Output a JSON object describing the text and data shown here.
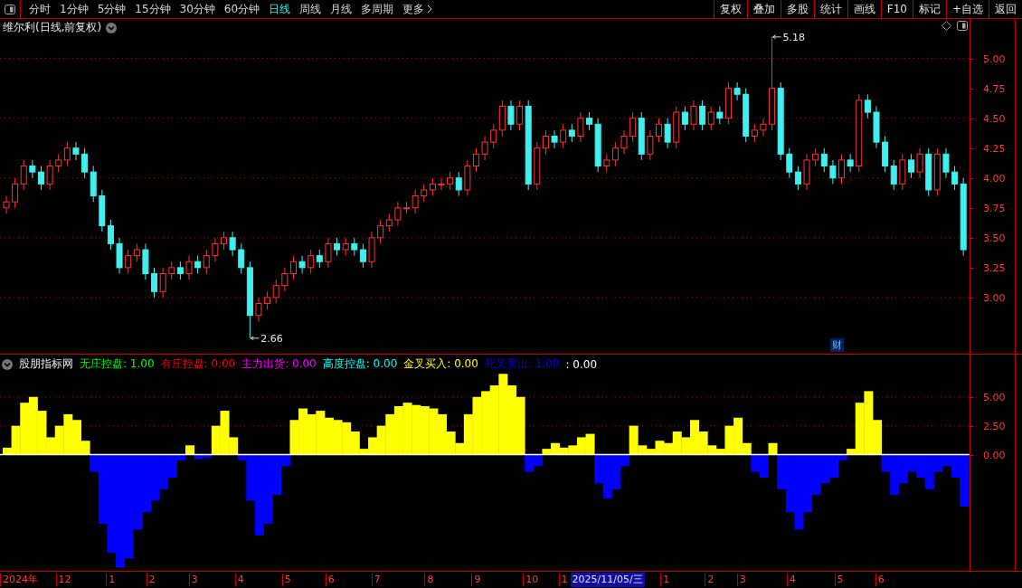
{
  "toolbar": {
    "periods": [
      {
        "label": "分时",
        "selected": false
      },
      {
        "label": "1分钟",
        "selected": false
      },
      {
        "label": "5分钟",
        "selected": false
      },
      {
        "label": "15分钟",
        "selected": false
      },
      {
        "label": "30分钟",
        "selected": false
      },
      {
        "label": "60分钟",
        "selected": false
      },
      {
        "label": "日线",
        "selected": true
      },
      {
        "label": "周线",
        "selected": false
      },
      {
        "label": "月线",
        "selected": false
      },
      {
        "label": "多周期",
        "selected": false
      },
      {
        "label": "更多",
        "selected": false
      }
    ],
    "buttons": [
      "复权",
      "叠加",
      "多股",
      "统计",
      "画线",
      "F10",
      "标记",
      "+自选",
      "返回"
    ]
  },
  "price_panel": {
    "title": "维尔利(日线,前复权)",
    "chart_data": {
      "type": "candlestick",
      "grid": true,
      "ylim": [
        2.53,
        5.33
      ],
      "ohlc": [
        [
          3.75,
          3.85,
          3.7,
          3.8
        ],
        [
          3.8,
          4.0,
          3.75,
          3.95
        ],
        [
          3.95,
          4.15,
          3.9,
          4.1
        ],
        [
          4.1,
          4.15,
          4.0,
          4.05
        ],
        [
          4.05,
          4.1,
          3.9,
          3.95
        ],
        [
          3.95,
          4.15,
          3.9,
          4.1
        ],
        [
          4.1,
          4.2,
          4.05,
          4.15
        ],
        [
          4.15,
          4.3,
          4.1,
          4.25
        ],
        [
          4.25,
          4.3,
          4.15,
          4.2
        ],
        [
          4.2,
          4.25,
          4.0,
          4.05
        ],
        [
          4.05,
          4.1,
          3.8,
          3.85
        ],
        [
          3.85,
          3.9,
          3.55,
          3.6
        ],
        [
          3.6,
          3.65,
          3.4,
          3.45
        ],
        [
          3.45,
          3.5,
          3.2,
          3.25
        ],
        [
          3.25,
          3.4,
          3.2,
          3.35
        ],
        [
          3.35,
          3.45,
          3.3,
          3.4
        ],
        [
          3.4,
          3.45,
          3.15,
          3.2
        ],
        [
          3.2,
          3.25,
          3.0,
          3.05
        ],
        [
          3.05,
          3.25,
          3.0,
          3.2
        ],
        [
          3.2,
          3.3,
          3.15,
          3.25
        ],
        [
          3.25,
          3.3,
          3.15,
          3.2
        ],
        [
          3.2,
          3.35,
          3.15,
          3.3
        ],
        [
          3.3,
          3.35,
          3.2,
          3.25
        ],
        [
          3.25,
          3.4,
          3.2,
          3.35
        ],
        [
          3.35,
          3.5,
          3.3,
          3.45
        ],
        [
          3.45,
          3.55,
          3.4,
          3.5
        ],
        [
          3.5,
          3.55,
          3.35,
          3.4
        ],
        [
          3.4,
          3.45,
          3.2,
          3.25
        ],
        [
          3.25,
          3.3,
          2.66,
          2.85
        ],
        [
          2.85,
          3.0,
          2.8,
          2.95
        ],
        [
          2.95,
          3.05,
          2.9,
          3.0
        ],
        [
          3.0,
          3.15,
          2.95,
          3.1
        ],
        [
          3.1,
          3.25,
          3.05,
          3.2
        ],
        [
          3.2,
          3.35,
          3.15,
          3.3
        ],
        [
          3.3,
          3.35,
          3.2,
          3.25
        ],
        [
          3.25,
          3.4,
          3.2,
          3.35
        ],
        [
          3.35,
          3.4,
          3.25,
          3.3
        ],
        [
          3.3,
          3.5,
          3.25,
          3.45
        ],
        [
          3.45,
          3.5,
          3.35,
          3.4
        ],
        [
          3.4,
          3.5,
          3.35,
          3.45
        ],
        [
          3.45,
          3.5,
          3.35,
          3.4
        ],
        [
          3.4,
          3.45,
          3.25,
          3.3
        ],
        [
          3.3,
          3.55,
          3.25,
          3.5
        ],
        [
          3.5,
          3.65,
          3.45,
          3.6
        ],
        [
          3.6,
          3.7,
          3.55,
          3.65
        ],
        [
          3.65,
          3.8,
          3.6,
          3.75
        ],
        [
          3.75,
          3.8,
          3.7,
          3.75
        ],
        [
          3.75,
          3.9,
          3.7,
          3.85
        ],
        [
          3.85,
          3.95,
          3.8,
          3.9
        ],
        [
          3.9,
          4.0,
          3.85,
          3.95
        ],
        [
          3.95,
          4.0,
          3.9,
          3.95
        ],
        [
          3.95,
          4.05,
          3.9,
          4.0
        ],
        [
          4.0,
          4.05,
          3.85,
          3.9
        ],
        [
          3.9,
          4.15,
          3.85,
          4.1
        ],
        [
          4.1,
          4.25,
          4.05,
          4.2
        ],
        [
          4.2,
          4.35,
          4.15,
          4.3
        ],
        [
          4.3,
          4.45,
          4.25,
          4.4
        ],
        [
          4.4,
          4.65,
          4.35,
          4.6
        ],
        [
          4.6,
          4.65,
          4.4,
          4.45
        ],
        [
          4.45,
          4.65,
          4.4,
          4.6
        ],
        [
          4.6,
          4.65,
          3.9,
          3.95
        ],
        [
          3.95,
          4.3,
          3.9,
          4.25
        ],
        [
          4.25,
          4.4,
          4.2,
          4.35
        ],
        [
          4.35,
          4.4,
          4.25,
          4.3
        ],
        [
          4.3,
          4.45,
          4.25,
          4.4
        ],
        [
          4.4,
          4.45,
          4.3,
          4.35
        ],
        [
          4.35,
          4.55,
          4.3,
          4.5
        ],
        [
          4.5,
          4.55,
          4.4,
          4.45
        ],
        [
          4.45,
          4.5,
          4.05,
          4.1
        ],
        [
          4.1,
          4.2,
          4.05,
          4.15
        ],
        [
          4.15,
          4.3,
          4.1,
          4.25
        ],
        [
          4.25,
          4.4,
          4.2,
          4.35
        ],
        [
          4.35,
          4.55,
          4.3,
          4.5
        ],
        [
          4.5,
          4.55,
          4.15,
          4.2
        ],
        [
          4.2,
          4.4,
          4.15,
          4.35
        ],
        [
          4.35,
          4.5,
          4.3,
          4.45
        ],
        [
          4.45,
          4.5,
          4.25,
          4.3
        ],
        [
          4.3,
          4.6,
          4.25,
          4.55
        ],
        [
          4.55,
          4.6,
          4.4,
          4.45
        ],
        [
          4.45,
          4.65,
          4.4,
          4.6
        ],
        [
          4.6,
          4.65,
          4.4,
          4.45
        ],
        [
          4.45,
          4.6,
          4.4,
          4.55
        ],
        [
          4.55,
          4.6,
          4.45,
          4.5
        ],
        [
          4.5,
          4.8,
          4.45,
          4.75
        ],
        [
          4.75,
          4.8,
          4.65,
          4.7
        ],
        [
          4.7,
          4.75,
          4.3,
          4.35
        ],
        [
          4.35,
          4.45,
          4.3,
          4.4
        ],
        [
          4.4,
          4.5,
          4.35,
          4.45
        ],
        [
          4.45,
          5.18,
          4.4,
          4.75
        ],
        [
          4.75,
          4.8,
          4.15,
          4.2
        ],
        [
          4.2,
          4.25,
          4.0,
          4.05
        ],
        [
          4.05,
          4.1,
          3.9,
          3.95
        ],
        [
          3.95,
          4.2,
          3.9,
          4.15
        ],
        [
          4.15,
          4.25,
          4.1,
          4.2
        ],
        [
          4.2,
          4.25,
          4.05,
          4.1
        ],
        [
          4.1,
          4.15,
          3.95,
          4.0
        ],
        [
          4.0,
          4.2,
          3.95,
          4.15
        ],
        [
          4.15,
          4.2,
          4.05,
          4.1
        ],
        [
          4.1,
          4.7,
          4.05,
          4.65
        ],
        [
          4.65,
          4.7,
          4.5,
          4.55
        ],
        [
          4.55,
          4.6,
          4.25,
          4.3
        ],
        [
          4.3,
          4.35,
          4.05,
          4.1
        ],
        [
          4.1,
          4.15,
          3.9,
          3.95
        ],
        [
          3.95,
          4.2,
          3.9,
          4.15
        ],
        [
          4.15,
          4.2,
          4.0,
          4.05
        ],
        [
          4.05,
          4.25,
          4.0,
          4.2
        ],
        [
          4.2,
          4.25,
          3.85,
          3.9
        ],
        [
          3.9,
          4.25,
          3.85,
          4.2
        ],
        [
          4.2,
          4.25,
          4.0,
          4.05
        ],
        [
          4.05,
          4.1,
          3.9,
          3.95
        ],
        [
          3.95,
          4.0,
          3.35,
          3.4
        ]
      ],
      "yticks": [
        {
          "value": 3,
          "label": "3.00"
        },
        {
          "value": 3.25,
          "label": "3.25"
        },
        {
          "value": 3.5,
          "label": "3.50"
        },
        {
          "value": 3.75,
          "label": "3.75"
        },
        {
          "value": 4,
          "label": "4.00"
        },
        {
          "value": 4.25,
          "label": "4.25"
        },
        {
          "value": 4.5,
          "label": "4.50"
        },
        {
          "value": 4.75,
          "label": "4.75"
        },
        {
          "value": 5,
          "label": "5.00"
        }
      ],
      "annotations": [
        "5.18",
        "2.66"
      ]
    },
    "badges": [
      {
        "text": "财"
      }
    ]
  },
  "date_axis": {
    "labels": [
      "2024年",
      "12",
      "1",
      "2",
      "3",
      "4",
      "5",
      "6",
      "7",
      "8",
      "9",
      "10",
      "1",
      "1",
      "2",
      "3",
      "4",
      "5",
      "6"
    ],
    "cursor_label": "2025/11/05/三"
  },
  "indicator_panel": {
    "name": "股朋指标网",
    "legend": [
      {
        "text": "无庄控盘: 1.00",
        "color": "#00ff00"
      },
      {
        "text": "有庄控盘: 0.00",
        "color": "#ff0000"
      },
      {
        "text": "主力出货: 0.00",
        "color": "#ff00ff"
      },
      {
        "text": "高度控盘: 0.00",
        "color": "#00ffff"
      },
      {
        "text": "金叉买入: 0.00",
        "color": "#ffff00"
      },
      {
        "text": "死叉卖出: 1.00",
        "color": "#0000ff"
      },
      {
        "text": ": 0.00",
        "color": "#ffffff"
      }
    ],
    "chart_data": {
      "type": "bar",
      "stacked": true,
      "grid": true,
      "ylim": [
        -10.08,
        8.67
      ],
      "yticks": [
        {
          "value": 0,
          "label": "0.00"
        },
        {
          "value": 2.5,
          "label": "2.50"
        },
        {
          "value": 5,
          "label": "5.00"
        }
      ],
      "series": [
        {
          "color": "#ffff00",
          "values": [
            0.6,
            2.5,
            4.5,
            5.0,
            3.8,
            1.5,
            2.5,
            3.5,
            3.0,
            1.2,
            null,
            null,
            null,
            null,
            null,
            null,
            null,
            null,
            null,
            null,
            null,
            0.8,
            null,
            null,
            2.5,
            3.8,
            1.5,
            null,
            null,
            null,
            null,
            null,
            null,
            3.0,
            4.0,
            3.5,
            3.8,
            3.2,
            3.0,
            2.8,
            2.0,
            0.5,
            1.5,
            2.5,
            3.5,
            4.2,
            4.5,
            4.3,
            4.2,
            4.0,
            3.5,
            2.0,
            1.0,
            3.5,
            5.0,
            5.5,
            6.0,
            7.0,
            6.0,
            5.0,
            null,
            null,
            0.5,
            1.0,
            0.6,
            0.8,
            1.5,
            1.8,
            null,
            null,
            null,
            null,
            2.5,
            0.8,
            0.5,
            1.2,
            1.0,
            2.0,
            1.5,
            3.0,
            2.0,
            0.8,
            0.5,
            2.5,
            3.2,
            1.0,
            null,
            null,
            1.0,
            null,
            null,
            null,
            null,
            null,
            null,
            null,
            null,
            0.5,
            4.5,
            5.5,
            3.0,
            null,
            null,
            null,
            null,
            null,
            null,
            null,
            null,
            null,
            null
          ]
        },
        {
          "color": "#0000ff",
          "values": [
            null,
            null,
            null,
            null,
            null,
            null,
            null,
            null,
            null,
            null,
            -1.5,
            -6.0,
            -8.5,
            -9.8,
            -9.0,
            -6.5,
            -5.0,
            -4.0,
            -3.0,
            -2.0,
            -0.5,
            null,
            -0.4,
            -0.3,
            null,
            null,
            null,
            -0.5,
            -4.0,
            -7.0,
            -6.0,
            -3.5,
            -1.0,
            null,
            null,
            null,
            null,
            null,
            null,
            null,
            null,
            null,
            null,
            null,
            null,
            null,
            null,
            null,
            null,
            null,
            null,
            null,
            null,
            null,
            null,
            null,
            null,
            null,
            null,
            null,
            -1.5,
            -1.0,
            null,
            null,
            null,
            null,
            null,
            null,
            -2.5,
            -3.8,
            -3.0,
            -1.0,
            null,
            null,
            null,
            null,
            null,
            null,
            null,
            null,
            null,
            null,
            null,
            null,
            null,
            null,
            -1.5,
            -2.0,
            null,
            -3.0,
            -5.0,
            -6.5,
            -5.0,
            -3.5,
            -2.5,
            -2.0,
            -0.5,
            null,
            null,
            null,
            null,
            -1.5,
            -3.5,
            -2.5,
            -1.5,
            -2.0,
            -3.0,
            -1.5,
            -1.0,
            -2.0,
            -4.5
          ]
        }
      ]
    }
  }
}
